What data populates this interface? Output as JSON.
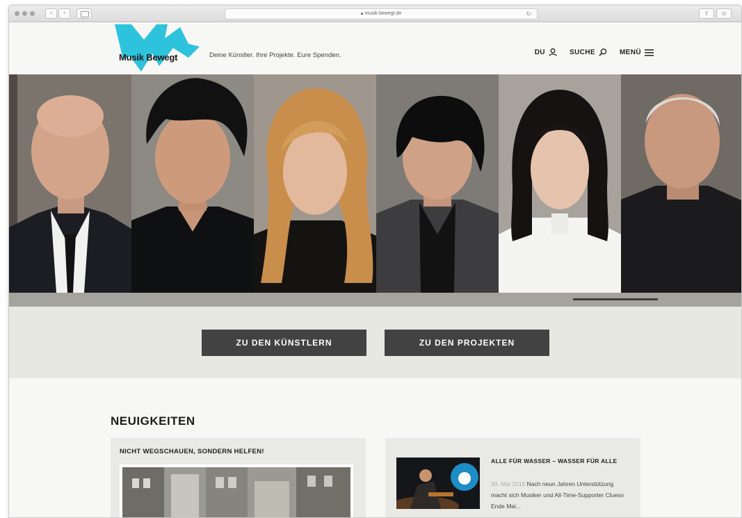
{
  "browser": {
    "url": "musik-bewegt.de"
  },
  "header": {
    "logo_text": "Musik Bewegt",
    "tagline": "Deine Künstler. Ihre Projekte. Eure Spenden.",
    "nav": [
      {
        "label": "DU",
        "icon": "user-icon"
      },
      {
        "label": "SUCHE",
        "icon": "search-icon"
      },
      {
        "label": "MENÜ",
        "icon": "hamburger-icon"
      }
    ]
  },
  "colors": {
    "brand_cyan": "#2ec3dd",
    "dark_button": "#434242",
    "band": "#e8e8e3"
  },
  "cta": {
    "artists": "ZU DEN KÜNSTLERN",
    "projects": "ZU DEN PROJEKTEN"
  },
  "news": {
    "title": "NEUIGKEITEN",
    "items": [
      {
        "title": "NICHT WEGSCHAUEN, SONDERN HELFEN!"
      },
      {
        "title": "ALLE FÜR WASSER – WASSER FÜR ALLE",
        "date": "30. Mai 2016",
        "excerpt": "Nach neun Jahren Unterstützung macht sich Musiker und All-Time-Supporter Clueso Ende Mai..."
      }
    ]
  }
}
